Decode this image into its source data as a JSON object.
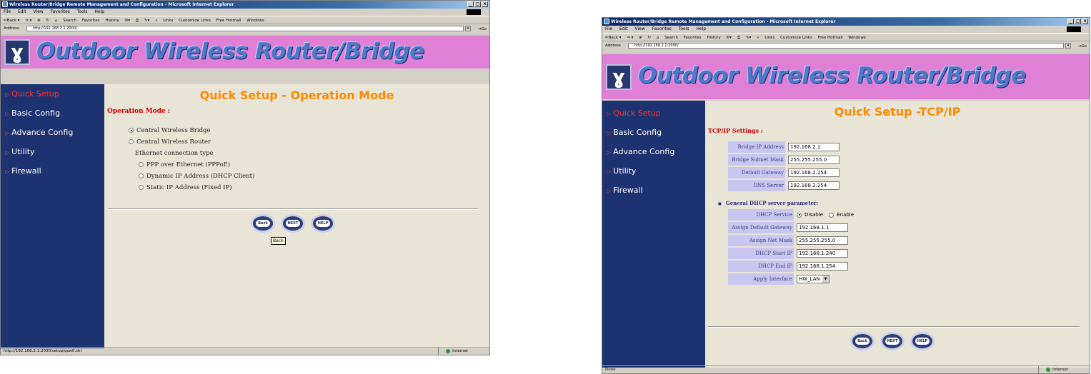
{
  "browser": {
    "title": "Wireless Router/Bridge Remote Management and Configuration - Microsoft Internet Explorer",
    "menu": [
      "File",
      "Edit",
      "View",
      "Favorites",
      "Tools",
      "Help"
    ],
    "toolbar": [
      "⇐Back ▾",
      "⇒ ▾",
      "⊗",
      "↻",
      "⌂",
      "Search",
      "Favorites",
      "History",
      "✉▾",
      "⎙",
      "✎▾",
      "»",
      "Links",
      "Customize Links",
      "Free Hotmail",
      "Windows"
    ],
    "address_label": "Address",
    "address_url": "http://192.168.2.1:2000/",
    "go_label": "→Go",
    "zone_label": "Internet",
    "window_controls": [
      "_",
      "□",
      "×"
    ]
  },
  "banner_title": "Outdoor Wireless Router/Bridge",
  "nav": [
    "Quick Setup",
    "Basic Config",
    "Advance Config",
    "Utility",
    "Firewall"
  ],
  "buttons": {
    "back": "Back",
    "next": "NEXT",
    "help": "HELP"
  },
  "window1": {
    "heading": "Quick Setup - Operation Mode",
    "section": "Operation Mode :",
    "options": {
      "bridge": "Central Wireless Bridge",
      "router": "Central Wireless Router",
      "eth_type": "Ethernet connection type",
      "pppoe": "PPP over Ethernet (PPPoE)",
      "dhcp": "Dynamic IP Address (DHCP Client)",
      "static": "Static IP Address (Fixed IP)"
    },
    "tooltip": "Back",
    "status_url": "http://192.168.2.1:2000/setup/qsw0.shi"
  },
  "window2": {
    "heading": "Quick Setup -TCP/IP",
    "section": "TCP/IP Settings :",
    "tcpip": [
      {
        "label": "Bridge IP Address",
        "value": "192.168.2.1"
      },
      {
        "label": "Bridge Subnet Mask",
        "value": "255.255.255.0"
      },
      {
        "label": "Default Gateway",
        "value": "192.168.2.254"
      },
      {
        "label": "DNS Server",
        "value": "192.168.2.254"
      }
    ],
    "dhcp_heading": "General DHCP server parameter:",
    "dhcp_service_label": "DHCP Service",
    "disable_label": "Disable",
    "enable_label": "Enable",
    "dhcp": [
      {
        "label": "Assign Default Gateway",
        "value": "192.168.1.1"
      },
      {
        "label": "Assign Net Mask",
        "value": "255.255.255.0"
      },
      {
        "label": "DHCP Start IP",
        "value": "192.168.1.240"
      },
      {
        "label": "DHCP End IP",
        "value": "192.168.1.254"
      }
    ],
    "apply_label": "Apply Interface",
    "apply_value": "HW_LAN",
    "status": "Done"
  },
  "colors": {
    "banner": "#e07fd6",
    "sidebar": "#1d3270",
    "heading": "#ff8a00",
    "section": "#cc0000",
    "content_bg": "#e8e4d6"
  }
}
